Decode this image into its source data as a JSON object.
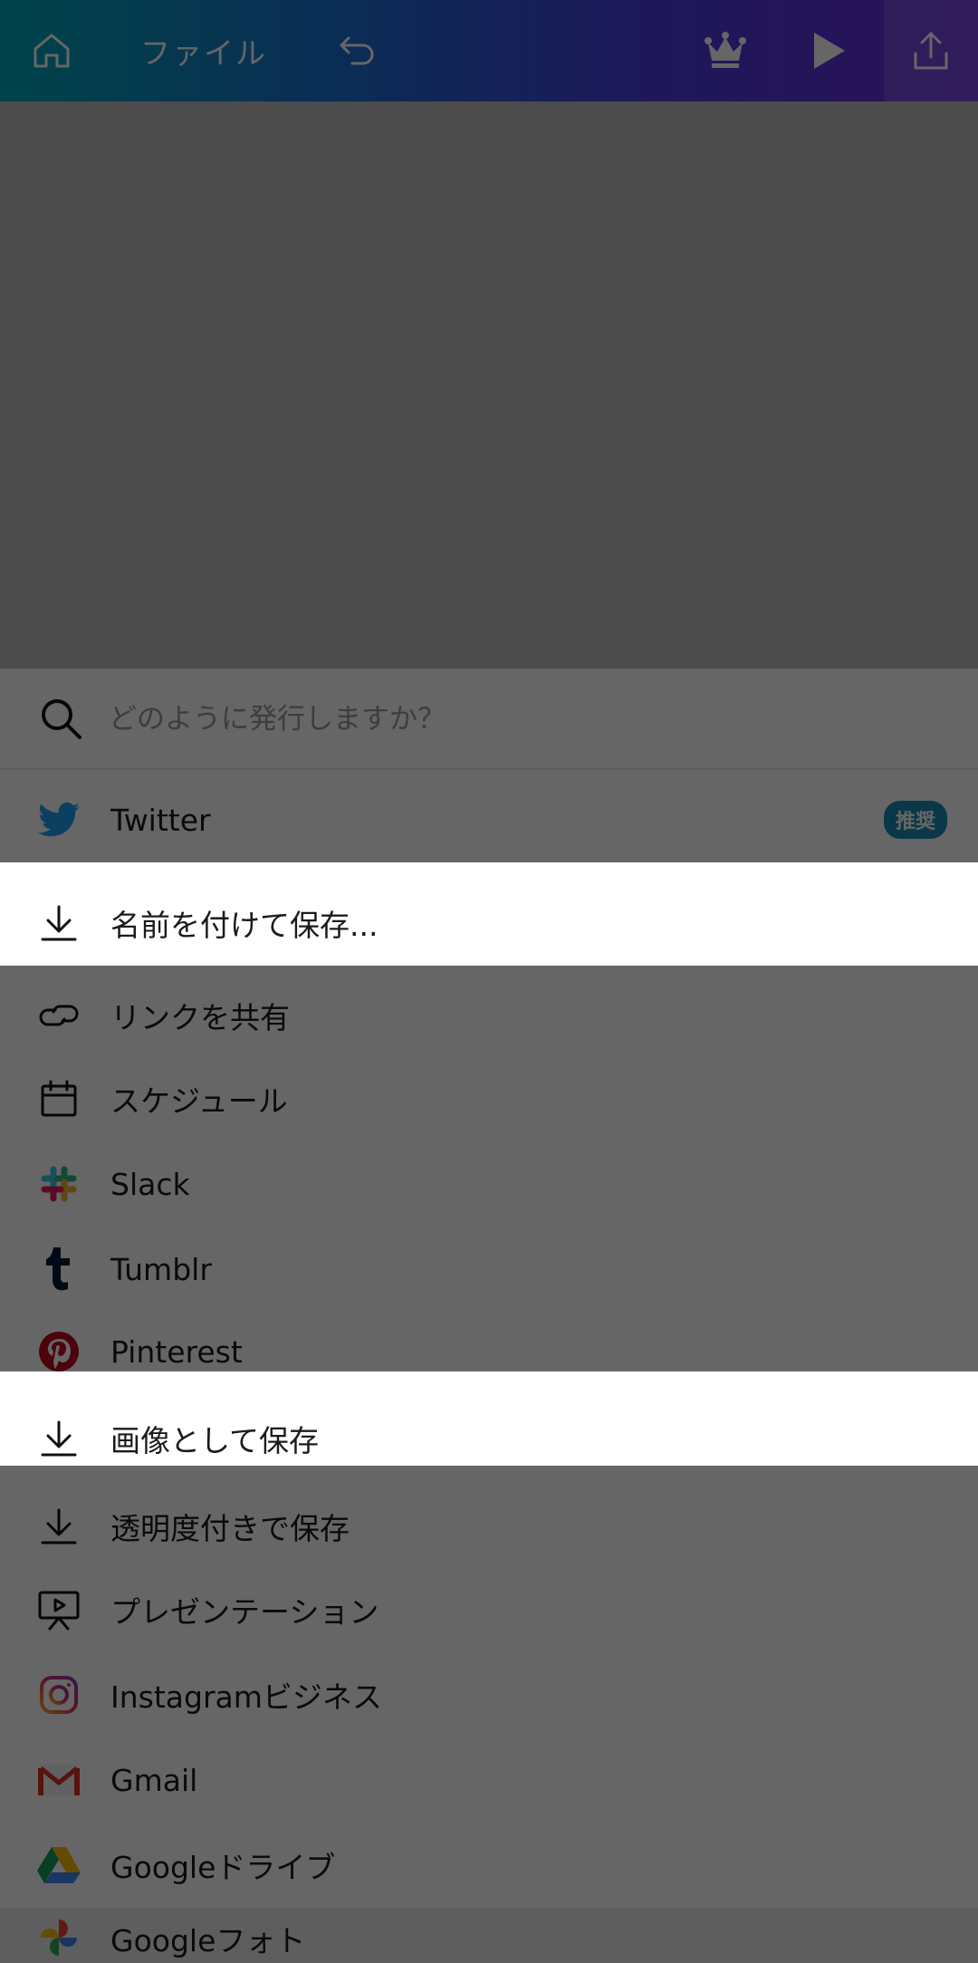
{
  "topbar": {
    "file_label": "ファイル"
  },
  "search": {
    "placeholder": "どのように発行しますか？"
  },
  "items": [
    {
      "label": "Twitter",
      "icon": "twitter-icon",
      "badge": "推奨"
    },
    {
      "label": "名前を付けて保存...",
      "icon": "download-icon"
    },
    {
      "label": "リンクを共有",
      "icon": "link-icon"
    },
    {
      "label": "スケジュール",
      "icon": "calendar-icon"
    },
    {
      "label": "Slack",
      "icon": "slack-icon"
    },
    {
      "label": "Tumblr",
      "icon": "tumblr-icon"
    },
    {
      "label": "Pinterest",
      "icon": "pinterest-icon"
    },
    {
      "label": "画像として保存",
      "icon": "download-icon"
    },
    {
      "label": "透明度付きで保存",
      "icon": "download-icon"
    },
    {
      "label": "プレゼンテーション",
      "icon": "presentation-icon"
    },
    {
      "label": "Instagramビジネス",
      "icon": "instagram-icon"
    },
    {
      "label": "Gmail",
      "icon": "gmail-icon"
    },
    {
      "label": "Googleドライブ",
      "icon": "google-drive-icon"
    },
    {
      "label": "Googleフォト",
      "icon": "google-photos-icon"
    }
  ],
  "colors": {
    "twitter": "#1da1f2",
    "pinterest": "#bd081c",
    "badge": "#1a8db5",
    "topbar_start": "#00a9b8",
    "topbar_end": "#6a2bdc"
  }
}
